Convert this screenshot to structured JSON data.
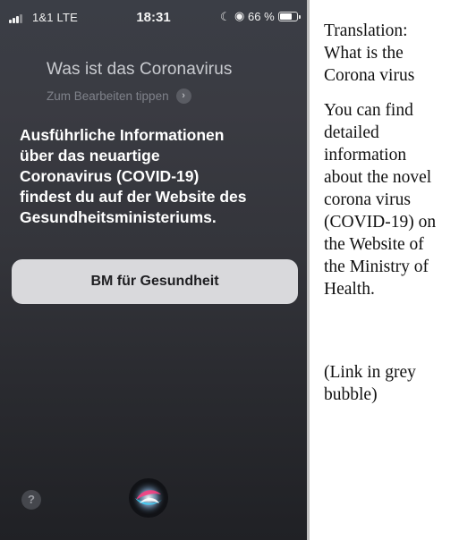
{
  "status_bar": {
    "carrier": "1&1  LTE",
    "time": "18:31",
    "moon_icon": "moon-icon",
    "orientation_icon": "orientation-lock-icon",
    "battery_text": "66 %",
    "battery_level": 0.66
  },
  "siri": {
    "query": "Was ist das Coronavirus",
    "edit_hint": "Zum Bearbeiten tippen",
    "edit_chevron": "›",
    "answer_lines": [
      "Ausführliche Informationen",
      "über das neuartige",
      "Coronavirus (COVID-19)",
      "findest du auf der Website des",
      "Gesundheitsministeriums."
    ],
    "link_label": "BM für Gesundheit",
    "help_label": "?"
  },
  "translation": {
    "heading_lines": [
      "Translation:",
      "What is the",
      "Corona virus"
    ],
    "body_lines": [
      "You can find",
      "detailed",
      "information",
      "about the novel",
      "corona virus",
      "(COVID-19) on",
      "the Website of",
      "the Ministry of",
      "Health."
    ],
    "note_lines": [
      "(Link in grey",
      "bubble)"
    ]
  },
  "colors": {
    "phone_bg_top": "#3b3e46",
    "phone_bg_bottom": "#202125",
    "bubble": "#d9d9dc",
    "answer_text": "#ffffff",
    "query_text": "#c9cbd0"
  }
}
